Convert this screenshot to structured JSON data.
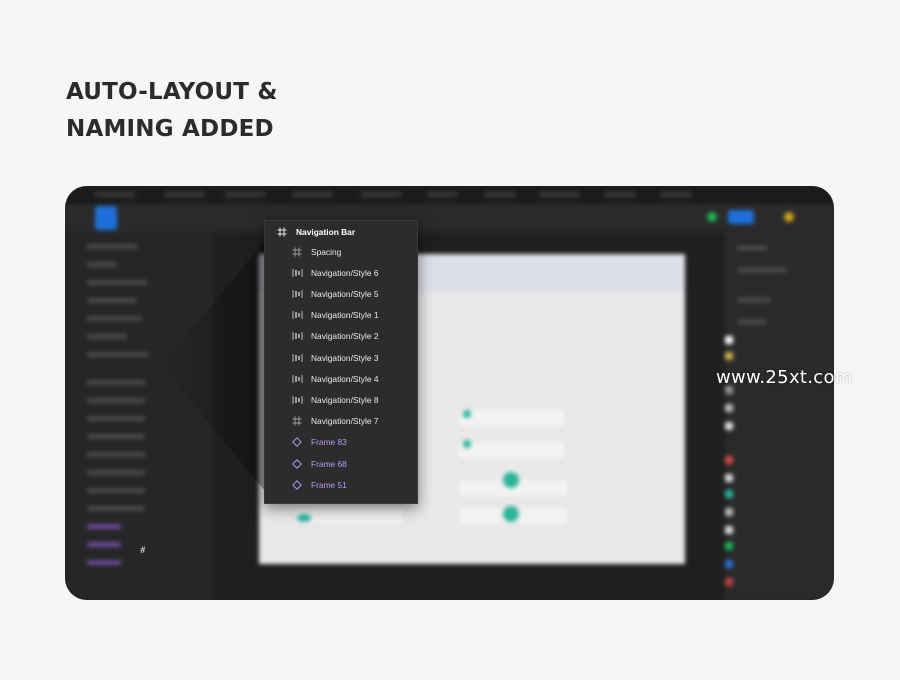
{
  "headline": {
    "line1": "AUTO-LAYOUT &",
    "line2": "NAMING ADDED"
  },
  "colors": {
    "page_bg": "#f6f6f6",
    "window_bg": "#242424",
    "accent_blue": "#1e6fd9",
    "frame_purple": "#b59cf1",
    "teal": "#2bb59b"
  },
  "layers_panel": {
    "header": {
      "label": "Navigation Bar",
      "icon": "frame-hash-icon"
    },
    "items": [
      {
        "label": "Spacing",
        "icon": "frame-hash-icon",
        "kind": "frame"
      },
      {
        "label": "Navigation/Style 6",
        "icon": "auto-layout-icon",
        "kind": "autolayout"
      },
      {
        "label": "Navigation/Style 5",
        "icon": "auto-layout-icon",
        "kind": "autolayout"
      },
      {
        "label": "Navigation/Style 1",
        "icon": "auto-layout-icon",
        "kind": "autolayout"
      },
      {
        "label": "Navigation/Style 2",
        "icon": "auto-layout-icon",
        "kind": "autolayout"
      },
      {
        "label": "Navigation/Style 3",
        "icon": "auto-layout-icon",
        "kind": "autolayout"
      },
      {
        "label": "Navigation/Style 4",
        "icon": "auto-layout-icon",
        "kind": "autolayout"
      },
      {
        "label": "Navigation/Style 8",
        "icon": "auto-layout-icon",
        "kind": "autolayout"
      },
      {
        "label": "Navigation/Style 7",
        "icon": "frame-hash-icon",
        "kind": "frame"
      },
      {
        "label": "Frame 83",
        "icon": "component-diamond-icon",
        "kind": "component"
      },
      {
        "label": "Frame 68",
        "icon": "component-diamond-icon",
        "kind": "component"
      },
      {
        "label": "Frame 51",
        "icon": "component-diamond-icon",
        "kind": "component"
      }
    ]
  },
  "watermark": "www.25xt.com"
}
